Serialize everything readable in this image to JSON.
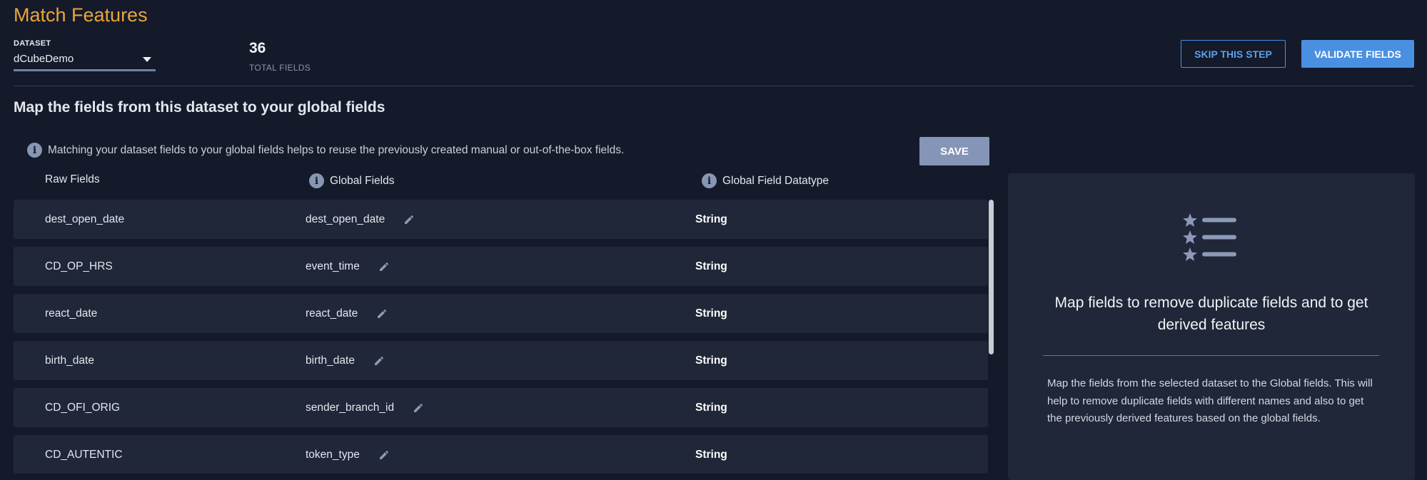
{
  "header": {
    "title": "Match Features",
    "dataset_label": "DATASET",
    "dataset_value": "dCubeDemo",
    "fields_count": "36",
    "fields_count_label": "TOTAL FIELDS",
    "skip_label": "SKIP THIS STEP",
    "validate_label": "VALIDATE FIELDS"
  },
  "main": {
    "heading": "Map the fields from this dataset to your global fields",
    "info_text": "Matching your dataset fields to your global fields helps to reuse the previously created manual or out-of-the-box fields.",
    "save_label": "SAVE",
    "columns": [
      "Raw Fields",
      "Global Fields",
      "Global Field Datatype"
    ],
    "rows": [
      {
        "raw": "dest_open_date",
        "global": "dest_open_date",
        "type": "String"
      },
      {
        "raw": "CD_OP_HRS",
        "global": "event_time",
        "type": "String"
      },
      {
        "raw": "react_date",
        "global": "react_date",
        "type": "String"
      },
      {
        "raw": "birth_date",
        "global": "birth_date",
        "type": "String"
      },
      {
        "raw": "CD_OFI_ORIG",
        "global": "sender_branch_id",
        "type": "String"
      },
      {
        "raw": "CD_AUTENTIC",
        "global": "token_type",
        "type": "String"
      }
    ]
  },
  "panel": {
    "title": "Map fields to remove duplicate fields and to get derived features",
    "description": "Map the fields from the selected dataset to the Global fields. This will help to remove duplicate fields with different names and also to get the previously derived features based on the global fields.",
    "icon": "starred-list-icon"
  },
  "colors": {
    "background": "#141a2a",
    "accent_title": "#e9a53a",
    "primary": "#4a90e2",
    "row_bg": "#1f2738"
  }
}
